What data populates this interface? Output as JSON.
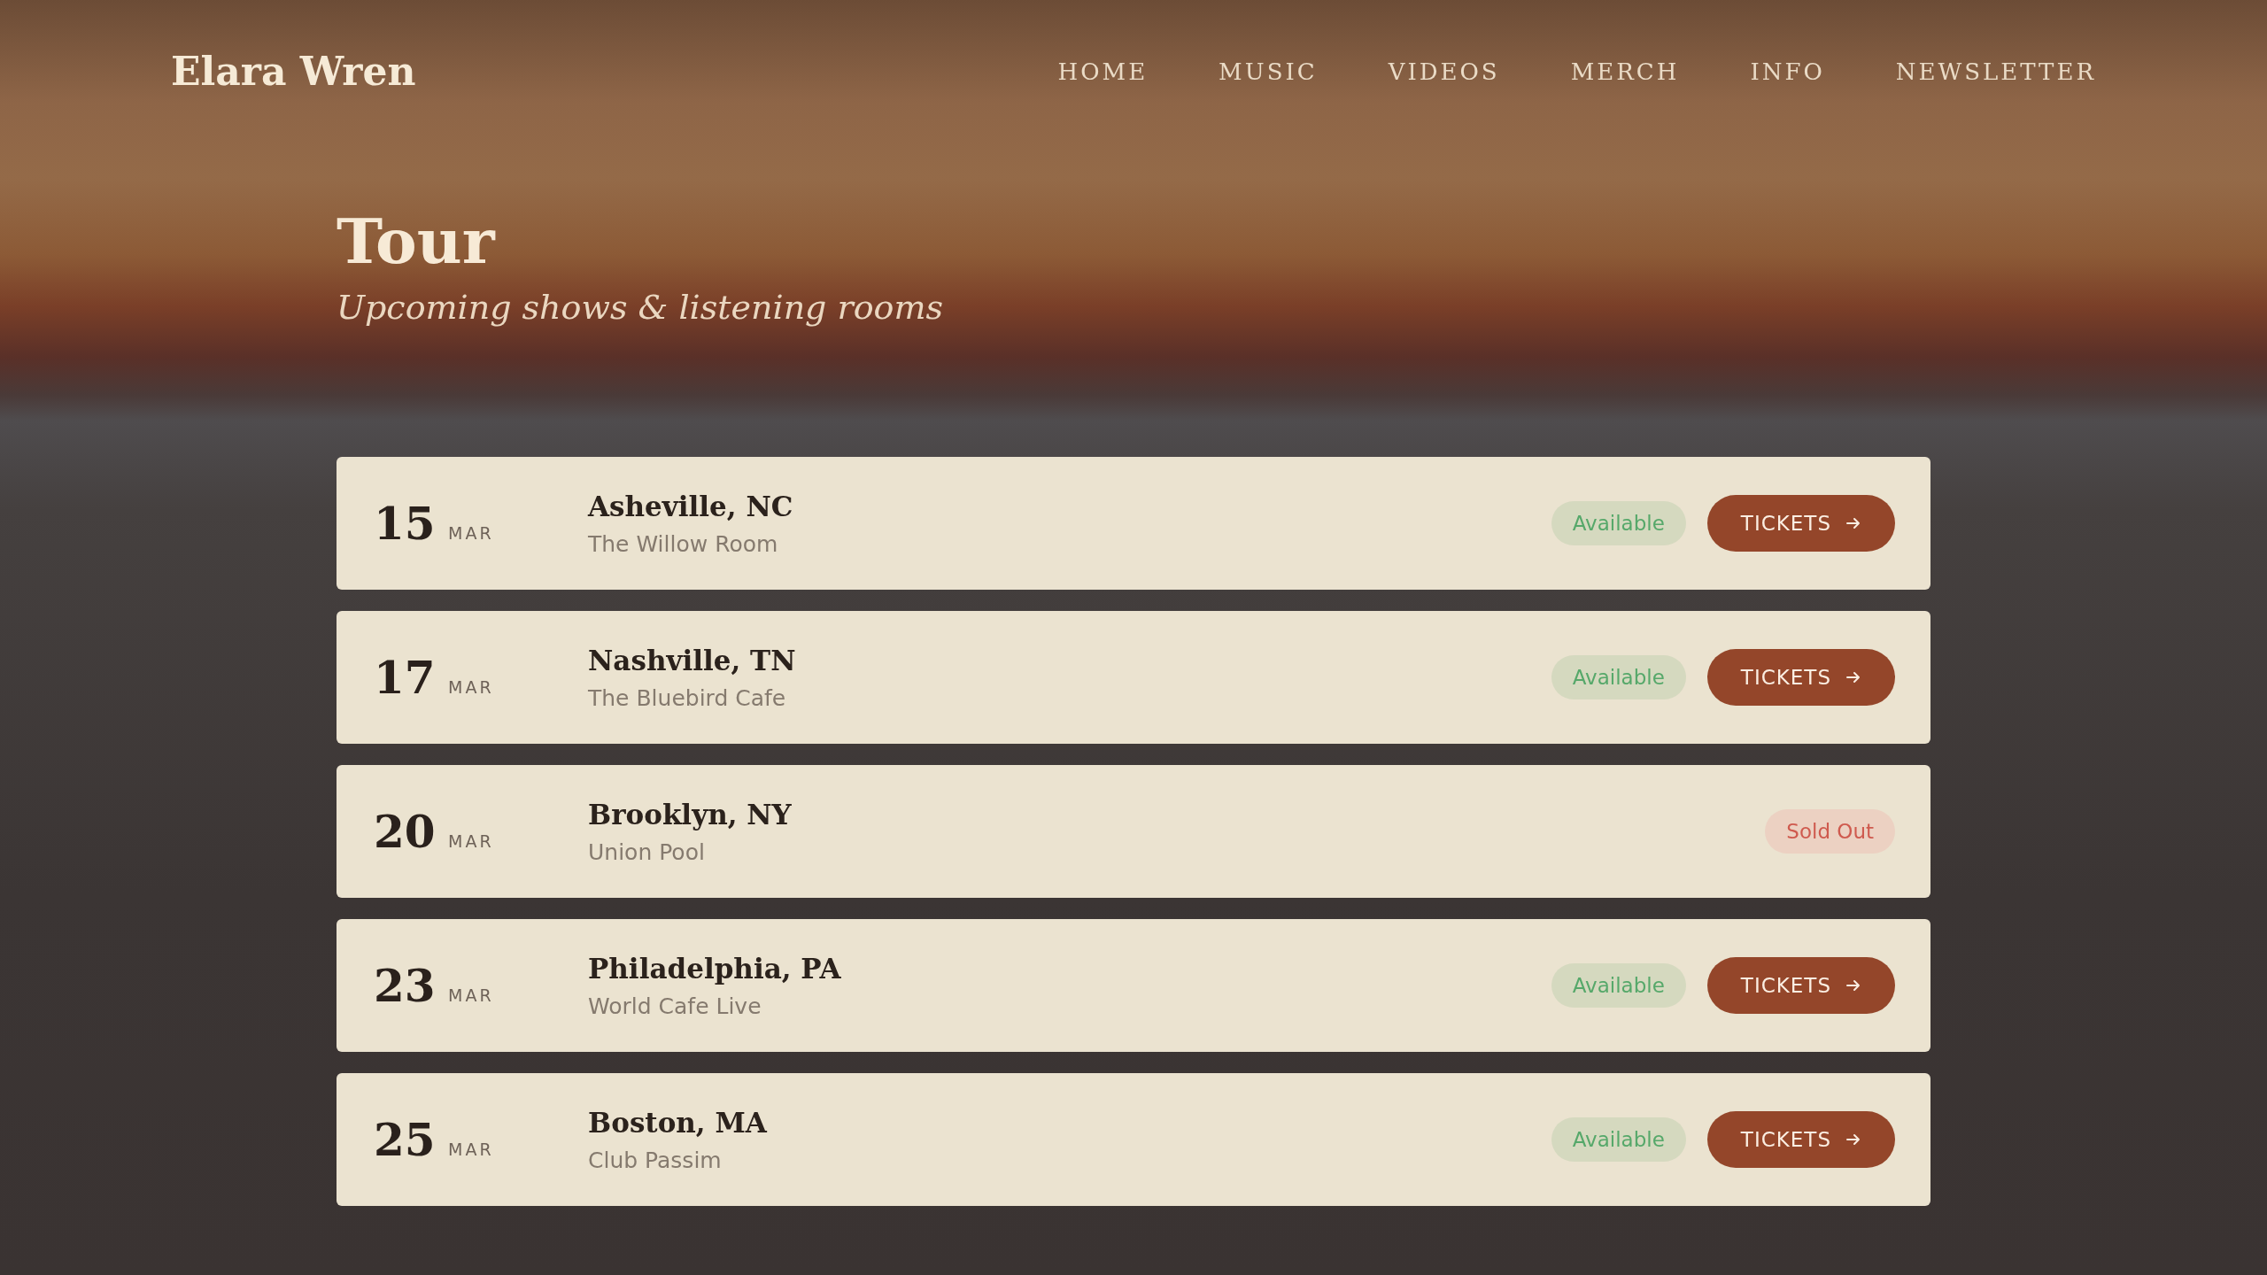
{
  "brand": "Elara Wren",
  "nav": [
    {
      "label": "HOME"
    },
    {
      "label": "MUSIC"
    },
    {
      "label": "VIDEOS"
    },
    {
      "label": "MERCH"
    },
    {
      "label": "INFO"
    },
    {
      "label": "NEWSLETTER"
    }
  ],
  "page": {
    "title": "Tour",
    "subtitle": "Upcoming shows & listening rooms"
  },
  "shows": [
    {
      "day": "15",
      "month": "MAR",
      "city": "Asheville, NC",
      "venue": "The Willow Room",
      "status": {
        "kind": "available",
        "label": "Available"
      },
      "button": "TICKETS"
    },
    {
      "day": "17",
      "month": "MAR",
      "city": "Nashville, TN",
      "venue": "The Bluebird Cafe",
      "status": {
        "kind": "available",
        "label": "Available"
      },
      "button": "TICKETS"
    },
    {
      "day": "20",
      "month": "MAR",
      "city": "Brooklyn, NY",
      "venue": "Union Pool",
      "status": {
        "kind": "sold_out",
        "label": "Sold Out"
      }
    },
    {
      "day": "23",
      "month": "MAR",
      "city": "Philadelphia, PA",
      "venue": "World Cafe Live",
      "status": {
        "kind": "available",
        "label": "Available"
      },
      "button": "TICKETS"
    },
    {
      "day": "25",
      "month": "MAR",
      "city": "Boston, MA",
      "venue": "Club Passim",
      "status": {
        "kind": "available",
        "label": "Available"
      },
      "button": "TICKETS"
    }
  ]
}
